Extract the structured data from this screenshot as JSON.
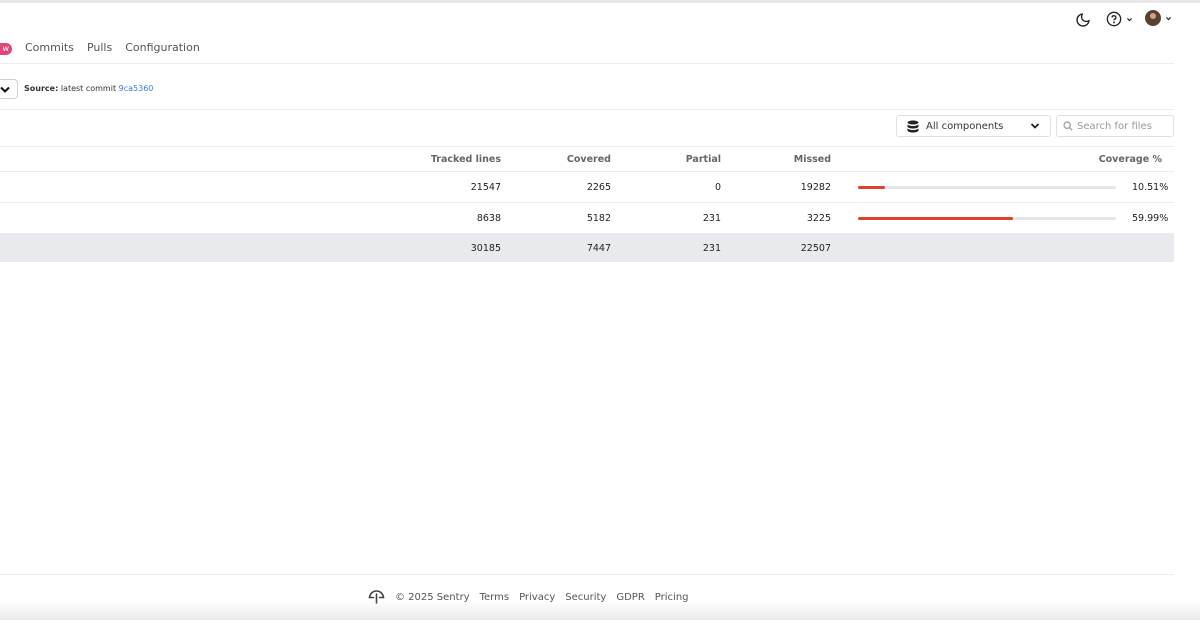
{
  "header": {
    "theme_icon": "moon-icon",
    "help_icon": "help-circle-icon",
    "user_icon": "avatar"
  },
  "nav": {
    "badge": "w",
    "tabs": [
      "Commits",
      "Pulls",
      "Configuration"
    ]
  },
  "source": {
    "label": "Source:",
    "text": "latest commit",
    "commit": "9ca5360"
  },
  "filters": {
    "components_label": "All components",
    "search_placeholder": "Search for files"
  },
  "table": {
    "headers": {
      "tracked": "Tracked lines",
      "covered": "Covered",
      "partial": "Partial",
      "missed": "Missed",
      "coverage": "Coverage %"
    },
    "rows": [
      {
        "tracked": "21547",
        "covered": "2265",
        "partial": "0",
        "missed": "19282",
        "coverage": "10.51%",
        "coverage_value": 10.51
      },
      {
        "tracked": "8638",
        "covered": "5182",
        "partial": "231",
        "missed": "3225",
        "coverage": "59.99%",
        "coverage_value": 59.99
      }
    ],
    "total": {
      "tracked": "30185",
      "covered": "7447",
      "partial": "231",
      "missed": "22507"
    }
  },
  "footer": {
    "copyright": "© 2025 Sentry",
    "links": [
      "Terms",
      "Privacy",
      "Security",
      "GDPR",
      "Pricing"
    ]
  },
  "colors": {
    "accent": "#e0457b",
    "bar_fill": "#e03e2f",
    "link": "#3b7bd6"
  }
}
